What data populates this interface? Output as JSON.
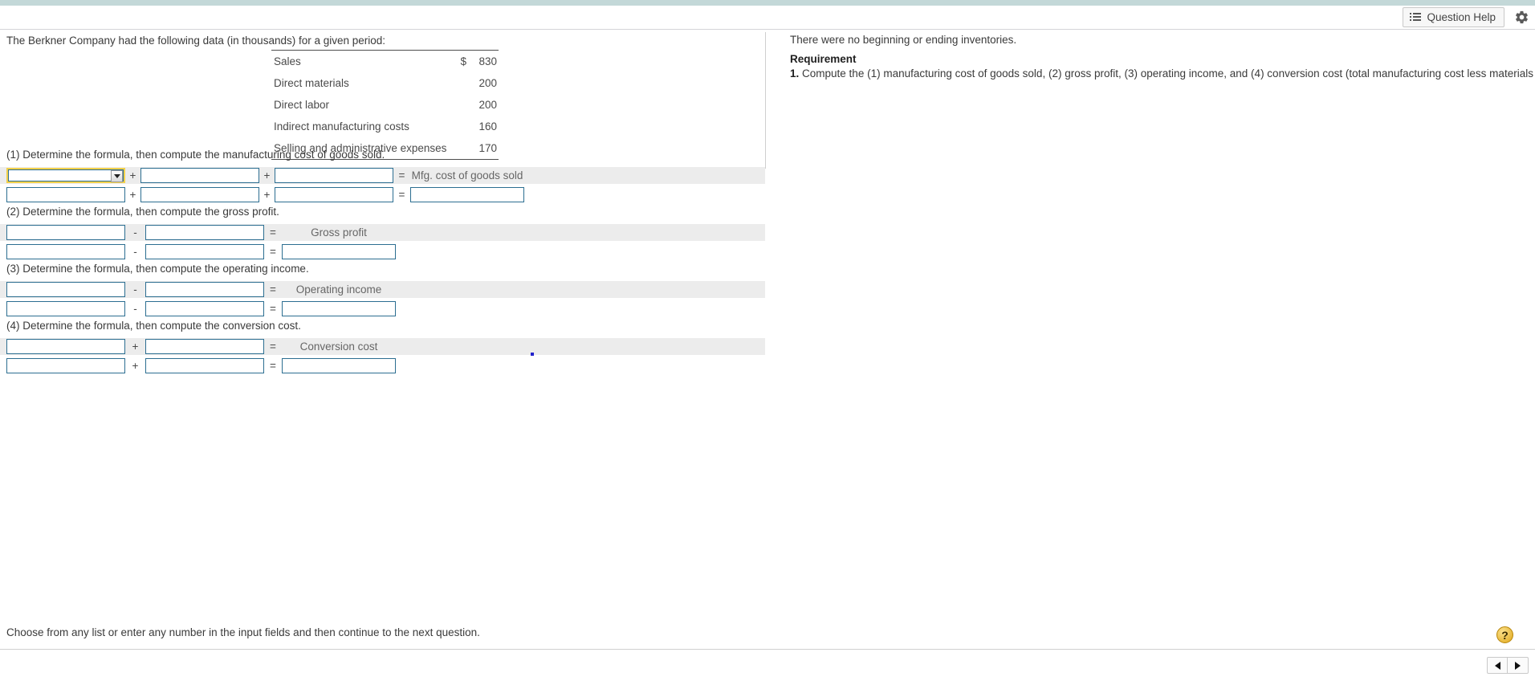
{
  "header": {
    "question_help_label": "Question Help",
    "list_icon": "list-icon",
    "gear_icon": "gear-icon"
  },
  "left_panel": {
    "intro": "The Berkner Company had the following data (in thousands) for a given period:",
    "table": {
      "rows": [
        {
          "label": "Sales",
          "currency": "$",
          "amount": "830"
        },
        {
          "label": "Direct materials",
          "currency": "",
          "amount": "200"
        },
        {
          "label": "Direct labor",
          "currency": "",
          "amount": "200"
        },
        {
          "label": "Indirect manufacturing costs",
          "currency": "",
          "amount": "160"
        },
        {
          "label": "Selling and administrative expenses",
          "currency": "",
          "amount": "170"
        }
      ]
    }
  },
  "right_panel": {
    "note": "There were no beginning or ending inventories.",
    "requirement_heading": "Requirement",
    "requirement_number": "1.",
    "requirement_text": "Compute the (1) manufacturing cost of goods sold, (2) gross profit, (3) operating income, and (4) conversion cost (total manufacturing cost less materials cost)."
  },
  "questions": [
    {
      "prompt": "(1) Determine the formula, then compute the manufacturing cost of goods sold.",
      "layout": "three-term",
      "op1": "+",
      "op2": "+",
      "eq": "=",
      "result_label": "Mfg. cost of goods sold",
      "formula_row": {
        "term1": "",
        "term2": "",
        "term3": ""
      },
      "value_row": {
        "term1": "",
        "term2": "",
        "term3": "",
        "result": ""
      },
      "term1_is_dropdown": true,
      "term1_focused": true
    },
    {
      "prompt": "(2) Determine the formula, then compute the gross profit.",
      "layout": "two-term",
      "op1": "-",
      "eq": "=",
      "result_label": "Gross profit",
      "formula_row": {
        "term1": "",
        "term2": ""
      },
      "value_row": {
        "term1": "",
        "term2": "",
        "result": ""
      },
      "term1_is_dropdown": false,
      "term1_focused": false
    },
    {
      "prompt": "(3) Determine the formula, then compute the operating income.",
      "layout": "two-term",
      "op1": "-",
      "eq": "=",
      "result_label": "Operating income",
      "formula_row": {
        "term1": "",
        "term2": ""
      },
      "value_row": {
        "term1": "",
        "term2": "",
        "result": ""
      },
      "term1_is_dropdown": false,
      "term1_focused": false
    },
    {
      "prompt": "(4) Determine the formula, then compute the conversion cost.",
      "layout": "two-term",
      "op1": "+",
      "eq": "=",
      "result_label": "Conversion cost",
      "formula_row": {
        "term1": "",
        "term2": ""
      },
      "value_row": {
        "term1": "",
        "term2": "",
        "result": ""
      },
      "term1_is_dropdown": false,
      "term1_focused": false
    }
  ],
  "footer": {
    "instruction": "Choose from any list or enter any number in the input fields and then continue to the next question.",
    "help_badge": "?",
    "prev_label": "◀",
    "next_label": "▶"
  },
  "colors": {
    "top_strip": "#c3d8d8",
    "field_border": "#2c6e91",
    "focus_border": "#f2d14b",
    "shaded_row": "#ececec",
    "help_badge": "#e0a81b"
  }
}
